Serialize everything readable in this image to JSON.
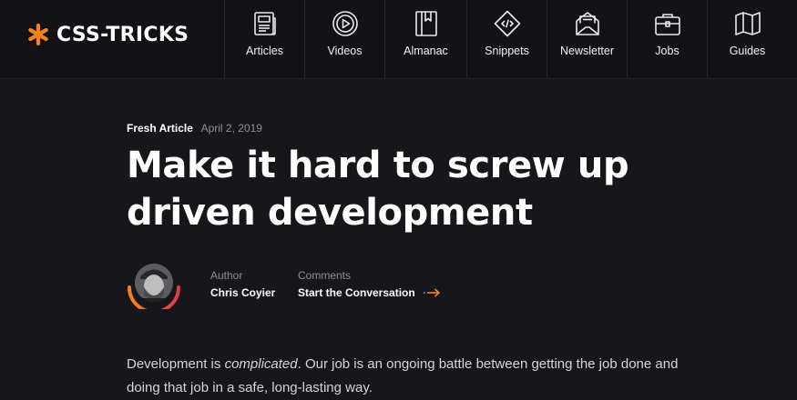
{
  "header": {
    "logo_text": "CSS-TRICKS",
    "accent_color": "#f5821f",
    "nav": [
      {
        "label": "Articles",
        "icon": "newspaper-icon"
      },
      {
        "label": "Videos",
        "icon": "play-circle-icon"
      },
      {
        "label": "Almanac",
        "icon": "book-icon"
      },
      {
        "label": "Snippets",
        "icon": "code-diamond-icon"
      },
      {
        "label": "Newsletter",
        "icon": "envelope-icon"
      },
      {
        "label": "Jobs",
        "icon": "briefcase-icon"
      },
      {
        "label": "Guides",
        "icon": "map-icon"
      }
    ]
  },
  "article": {
    "tag": "Fresh Article",
    "date": "April 2, 2019",
    "title": "Make it hard to screw up driven development",
    "author_label": "Author",
    "author_name": "Chris Coyier",
    "comments_label": "Comments",
    "comments_link": "Start the Conversation",
    "body_prefix": "Development is ",
    "body_emphasis": "complicated",
    "body_suffix": ". Our job is an ongoing battle between getting the job done and doing that job in a safe, long-lasting way."
  }
}
